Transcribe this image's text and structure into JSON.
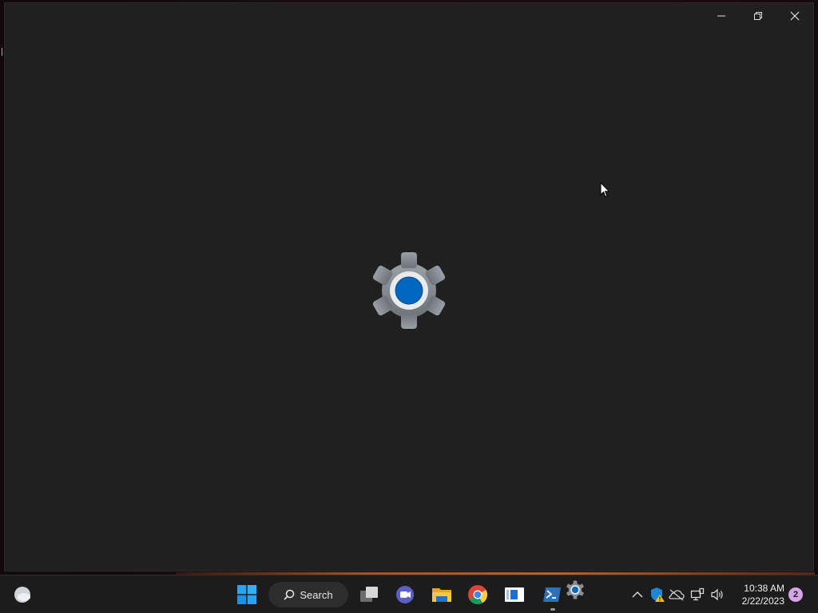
{
  "window": {
    "title": "Settings",
    "controls": {
      "minimize": "minimize",
      "restore": "restore",
      "close": "close"
    },
    "splash_icon": "settings-gear-icon"
  },
  "taskbar": {
    "search_label": "Search",
    "pinned": [
      {
        "name": "start-button",
        "icon": "windows-logo-icon"
      },
      {
        "name": "task-view",
        "icon": "task-view-icon"
      },
      {
        "name": "teams-chat",
        "icon": "teams-chat-icon"
      },
      {
        "name": "file-explorer",
        "icon": "folder-icon"
      },
      {
        "name": "chrome",
        "icon": "chrome-icon"
      },
      {
        "name": "notepad-app",
        "icon": "app-window-icon"
      },
      {
        "name": "powershell",
        "icon": "powershell-icon"
      },
      {
        "name": "settings",
        "icon": "settings-gear-icon"
      }
    ],
    "tray": {
      "icons": [
        "chevron-up-icon",
        "security-shield-icon",
        "onedrive-icon",
        "network-icon",
        "volume-icon"
      ]
    },
    "clock": {
      "time": "10:38 AM",
      "date": "2/22/2023"
    },
    "notification_count": "2"
  },
  "colors": {
    "window_bg": "#202020",
    "taskbar_bg": "#1c1c1c",
    "accent_blue": "#0067c0",
    "gear_gray": "#8a8f96"
  }
}
